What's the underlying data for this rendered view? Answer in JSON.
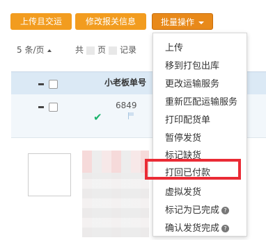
{
  "toolbar": {
    "upload_label": "上传且交运",
    "modify_label": "修改报关信息",
    "batch_label": "批量操作"
  },
  "pager": {
    "page_size": "5 条/页",
    "total_prefix": "共",
    "total_mid": "页",
    "total_suffix": "记录"
  },
  "table": {
    "col_order_no": "小老板单号",
    "row1": {
      "order_no": "6849"
    }
  },
  "menu": {
    "items": [
      "上传",
      "移到打包出库",
      "更改运输服务",
      "重新匹配运输服务",
      "打印配货单",
      "暂停发货",
      "标记缺货",
      "打回已付款",
      "虚拟发货",
      "标记为已完成",
      "确认发货完成"
    ]
  },
  "colors": {
    "accent": "#f29c1f",
    "highlight": "#ea2b35",
    "header_bg": "#dbe9f5"
  }
}
